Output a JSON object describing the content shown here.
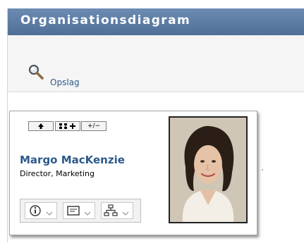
{
  "header": {
    "title": "Organisationsdiagram"
  },
  "lookup": {
    "label": "Opslag",
    "icon": "magnifier-icon"
  },
  "card": {
    "nav_buttons": [
      "up-arrow-icon",
      "hierarchy-plus-icon",
      "expand-collapse-icon"
    ],
    "expand_collapse_label": "+/−",
    "name": "Margo MacKenzie",
    "title": "Director, Marketing",
    "actions": [
      "info-icon",
      "message-icon",
      "org-chart-icon"
    ]
  },
  "colors": {
    "title_bar": "#5a7aa3",
    "link": "#2d5a8c",
    "lookup_bg": "#f5f5f5"
  }
}
